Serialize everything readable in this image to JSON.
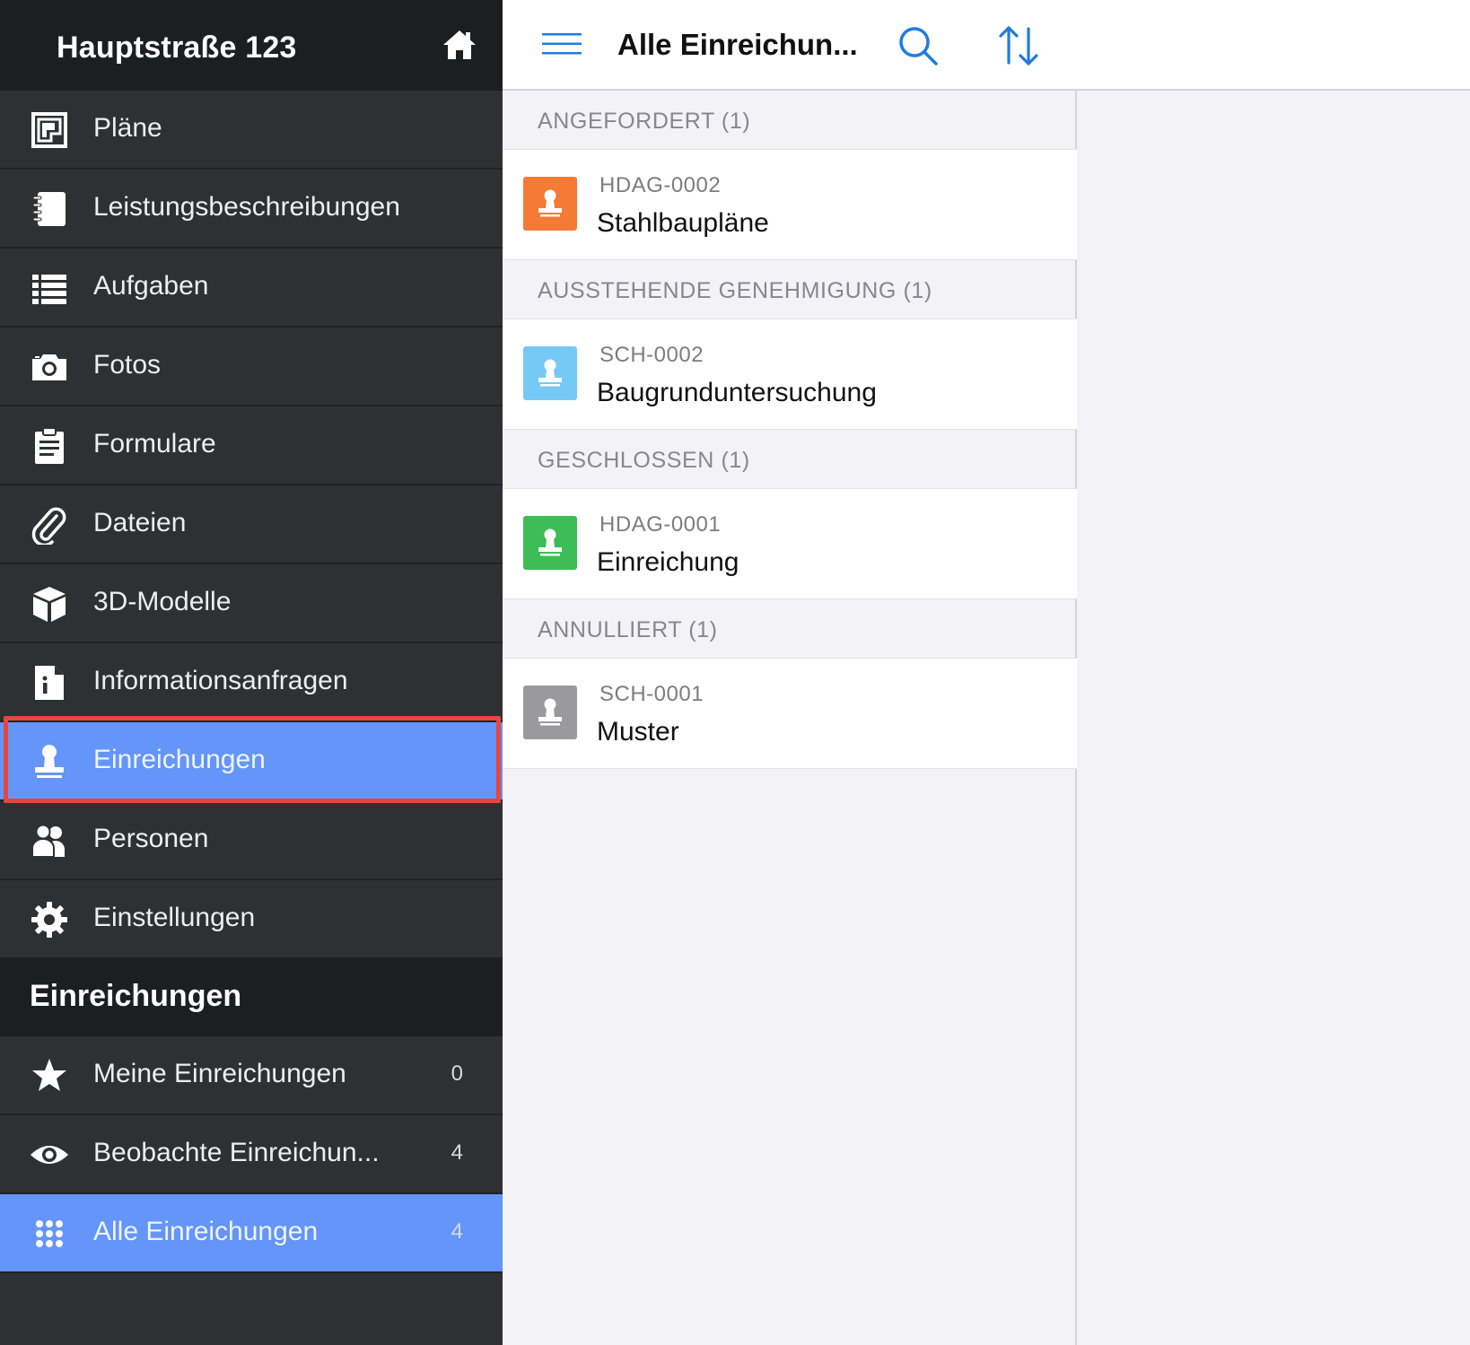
{
  "sidebar": {
    "project_title": "Hauptstraße 123",
    "home_icon": "home-icon",
    "nav": [
      {
        "label": "Pläne",
        "icon": "floorplan-icon"
      },
      {
        "label": "Leistungsbeschreibungen",
        "icon": "notebook-icon"
      },
      {
        "label": "Aufgaben",
        "icon": "list-icon"
      },
      {
        "label": "Fotos",
        "icon": "camera-icon"
      },
      {
        "label": "Formulare",
        "icon": "clipboard-icon"
      },
      {
        "label": "Dateien",
        "icon": "paperclip-icon"
      },
      {
        "label": "3D-Modelle",
        "icon": "cube-icon"
      },
      {
        "label": "Informationsanfragen",
        "icon": "info-document-icon"
      },
      {
        "label": "Einreichungen",
        "icon": "stamp-icon",
        "selected": true
      },
      {
        "label": "Personen",
        "icon": "people-icon"
      },
      {
        "label": "Einstellungen",
        "icon": "gear-icon"
      }
    ],
    "section_title": "Einreichungen",
    "filters": [
      {
        "label": "Meine Einreichungen",
        "count": "0",
        "icon": "star-icon"
      },
      {
        "label": "Beobachte Einreichun...",
        "count": "4",
        "icon": "eye-icon"
      },
      {
        "label": "Alle Einreichungen",
        "count": "4",
        "icon": "grid-dots-icon",
        "selected": true
      }
    ],
    "selected_color": "#6495f8",
    "highlight_color": "#e5463e"
  },
  "list": {
    "title": "Alle Einreichun...",
    "accent_color": "#1f7ce0",
    "groups": [
      {
        "header": "ANGEFORDERT (1)",
        "items": [
          {
            "code": "HDAG-0002",
            "name": "Stahlbaupläne",
            "color": "#f47a36"
          }
        ]
      },
      {
        "header": "AUSSTEHENDE GENEHMIGUNG (1)",
        "items": [
          {
            "code": "SCH-0002",
            "name": "Baugrunduntersuchung",
            "color": "#76c9f5"
          }
        ]
      },
      {
        "header": "GESCHLOSSEN (1)",
        "items": [
          {
            "code": "HDAG-0001",
            "name": "Einreichung",
            "color": "#3dbd55"
          }
        ]
      },
      {
        "header": "ANNULLIERT (1)",
        "items": [
          {
            "code": "SCH-0001",
            "name": "Muster",
            "color": "#9a9a9e"
          }
        ]
      }
    ]
  }
}
